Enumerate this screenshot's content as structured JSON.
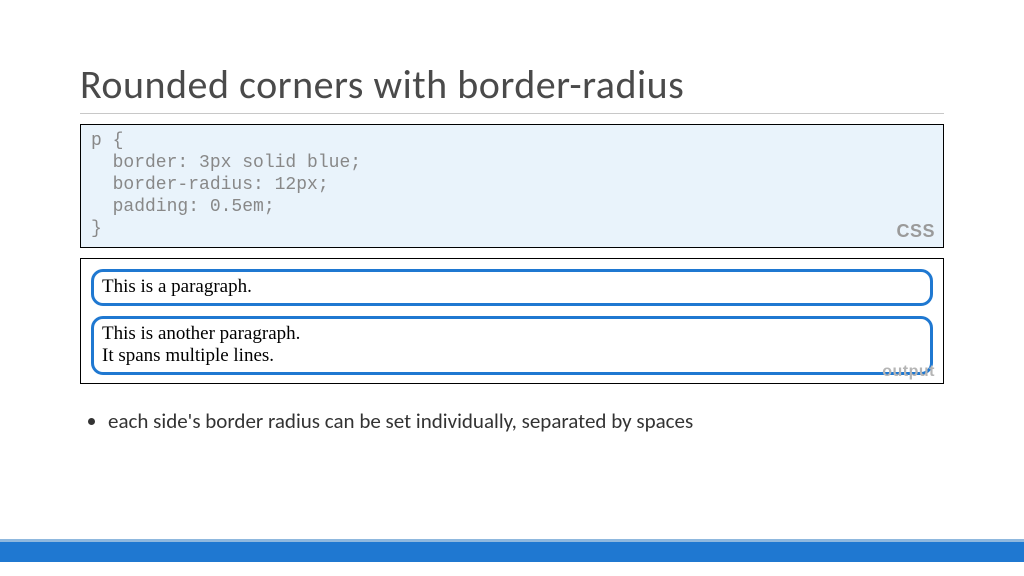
{
  "title": "Rounded corners with border-radius",
  "code": {
    "text": "p {\n  border: 3px solid blue;\n  border-radius: 12px;\n  padding: 0.5em;\n}",
    "lang_label": "CSS"
  },
  "output": {
    "paragraphs": [
      "This is a paragraph.",
      "This is another paragraph.\nIt spans multiple lines."
    ],
    "label": "output"
  },
  "bullets": [
    "each side's border radius can be set individually, separated by spaces"
  ]
}
